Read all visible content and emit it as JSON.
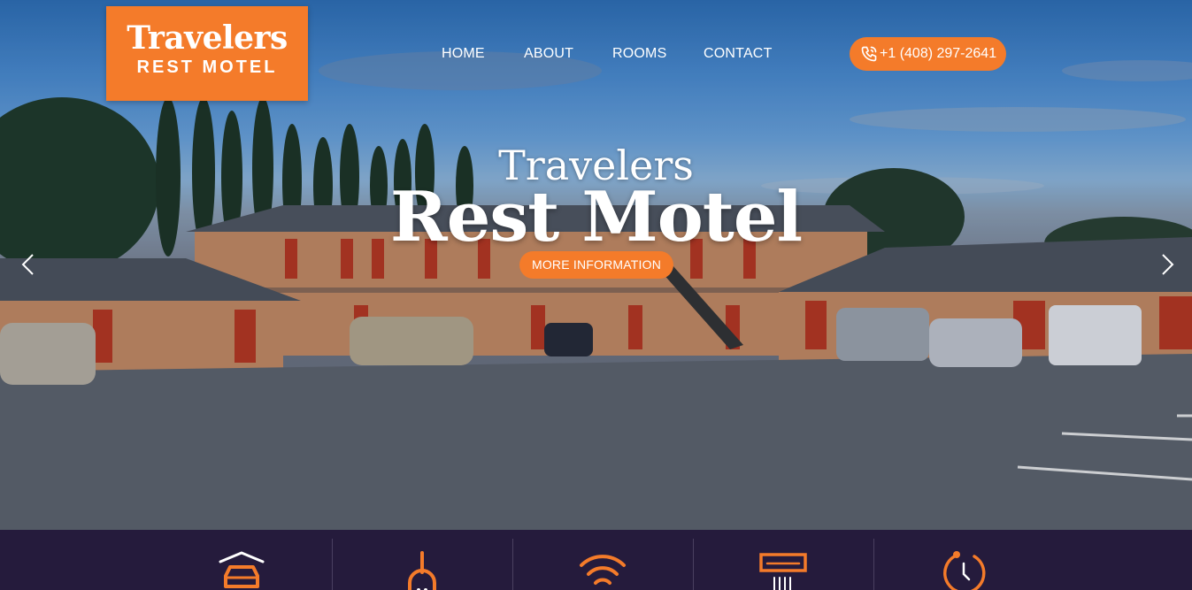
{
  "logo": {
    "line1": "Travelers",
    "line2": "REST MOTEL"
  },
  "nav": {
    "items": [
      "HOME",
      "ABOUT",
      "ROOMS",
      "CONTACT"
    ]
  },
  "phone": {
    "number": "+1 (408) 297-2641",
    "icon": "phone-icon"
  },
  "hero": {
    "title_small": "Travelers",
    "title_big": "Rest Motel",
    "button_label": "MORE INFORMATION",
    "prev_icon": "chevron-left-icon",
    "next_icon": "chevron-right-icon"
  },
  "amenities": {
    "icons": [
      "covered-parking-icon",
      "iron-icon",
      "wifi-icon",
      "air-conditioner-icon",
      "clock-icon"
    ]
  },
  "colors": {
    "accent": "#f47b2a",
    "bar_bg": "#251b3c",
    "text": "#ffffff"
  }
}
